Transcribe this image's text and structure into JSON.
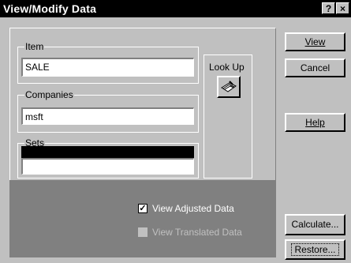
{
  "window": {
    "title": "View/Modify Data",
    "help_glyph": "?",
    "close_glyph": "×"
  },
  "item_group": {
    "legend": "Item",
    "value": "SALE"
  },
  "companies_group": {
    "legend": "Companies",
    "value": "msft"
  },
  "sets_group": {
    "legend": "Sets",
    "value": ""
  },
  "lookup": {
    "label": "Look Up"
  },
  "buttons": {
    "view": "View",
    "cancel": "Cancel",
    "help": "Help",
    "calculate": "Calculate...",
    "restore": "Restore..."
  },
  "options": {
    "view_adjusted": {
      "label": "View Adjusted Data",
      "checked": true
    },
    "view_translated": {
      "label": "View Translated Data",
      "checked": false
    }
  }
}
